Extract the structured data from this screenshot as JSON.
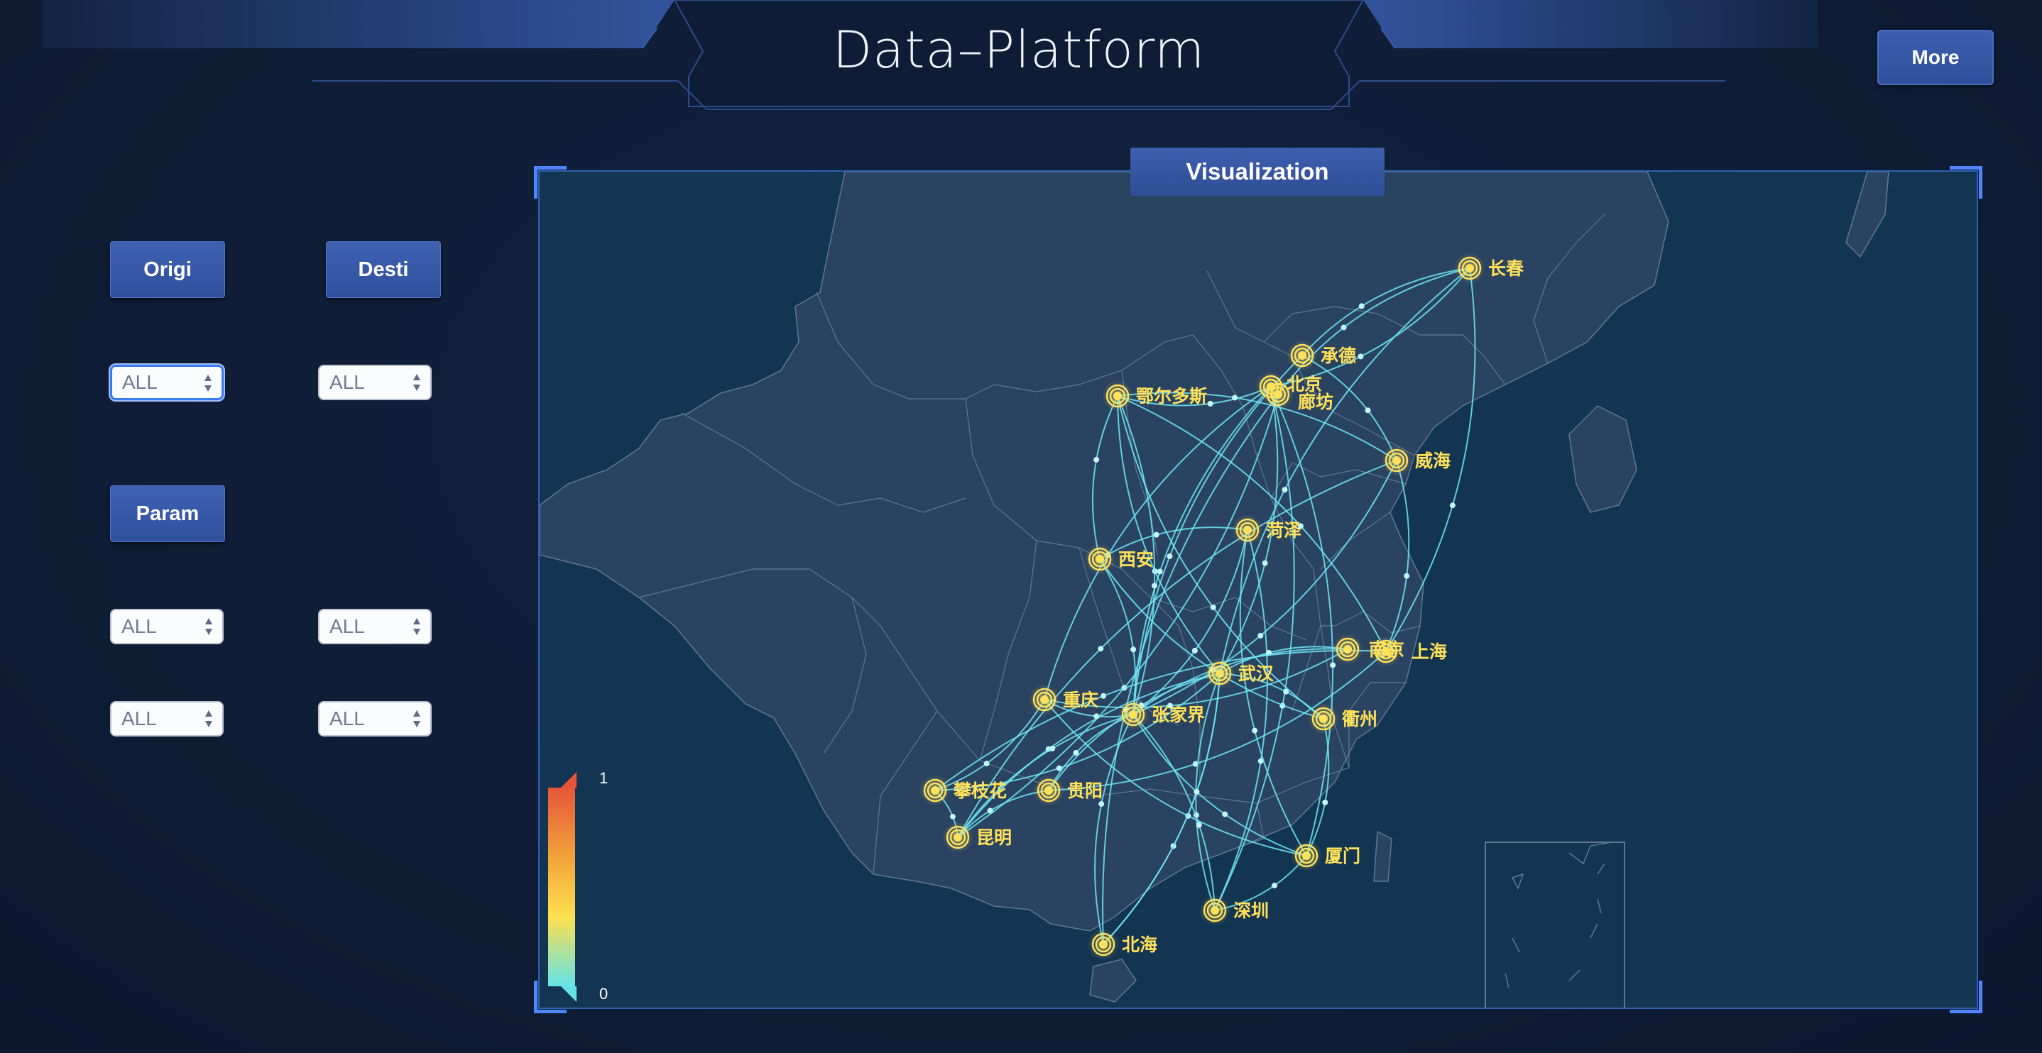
{
  "header": {
    "title": "Data–Platform",
    "more_label": "More"
  },
  "filters": {
    "origin_label": "Origi",
    "destination_label": "Desti",
    "param_label": "Param",
    "origin_value": "ALL",
    "destination_value": "ALL",
    "param_values": [
      "ALL",
      "ALL",
      "ALL",
      "ALL"
    ]
  },
  "visualization": {
    "tab_label": "Visualization",
    "legend": {
      "max_label": "1",
      "min_label": "0"
    },
    "colors": {
      "line": "#6fe6f5",
      "city": "#ffe15a",
      "panel": "#133551",
      "accent": "#3f61b1"
    },
    "cities": [
      "长春",
      "承德",
      "北京",
      "廊坊",
      "鄂尔多斯",
      "威海",
      "菏泽",
      "西安",
      "南京",
      "上海",
      "武汉",
      "重庆",
      "张家界",
      "衢州",
      "攀枝花",
      "贵阳",
      "昆明",
      "厦门",
      "深圳",
      "北海"
    ],
    "flows": [
      [
        "长春",
        "承德"
      ],
      [
        "长春",
        "北京"
      ],
      [
        "长春",
        "廊坊"
      ],
      [
        "长春",
        "上海"
      ],
      [
        "长春",
        "武汉"
      ],
      [
        "北京",
        "武汉"
      ],
      [
        "北京",
        "张家界"
      ],
      [
        "北京",
        "深圳"
      ],
      [
        "北京",
        "重庆"
      ],
      [
        "北京",
        "厦门"
      ],
      [
        "廊坊",
        "北海"
      ],
      [
        "廊坊",
        "昆明"
      ],
      [
        "承德",
        "张家界"
      ],
      [
        "承德",
        "威海"
      ],
      [
        "鄂尔多斯",
        "武汉"
      ],
      [
        "鄂尔多斯",
        "张家界"
      ],
      [
        "鄂尔多斯",
        "北京"
      ],
      [
        "鄂尔多斯",
        "上海"
      ],
      [
        "鄂尔多斯",
        "衢州"
      ],
      [
        "威海",
        "张家界"
      ],
      [
        "威海",
        "鄂尔多斯"
      ],
      [
        "威海",
        "上海"
      ],
      [
        "威海",
        "昆明"
      ],
      [
        "菏泽",
        "张家界"
      ],
      [
        "菏泽",
        "西安"
      ],
      [
        "菏泽",
        "深圳"
      ],
      [
        "菏泽",
        "厦门"
      ],
      [
        "西安",
        "鄂尔多斯"
      ],
      [
        "西安",
        "衢州"
      ],
      [
        "西安",
        "张家界"
      ],
      [
        "南京",
        "张家界"
      ],
      [
        "南京",
        "重庆"
      ],
      [
        "南京",
        "武汉"
      ],
      [
        "上海",
        "贵阳"
      ],
      [
        "上海",
        "攀枝花"
      ],
      [
        "武汉",
        "攀枝花"
      ],
      [
        "武汉",
        "深圳"
      ],
      [
        "武汉",
        "北海"
      ],
      [
        "武汉",
        "昆明"
      ],
      [
        "武汉",
        "衢州"
      ],
      [
        "重庆",
        "厦门"
      ],
      [
        "重庆",
        "攀枝花"
      ],
      [
        "张家界",
        "贵阳"
      ],
      [
        "张家界",
        "深圳"
      ],
      [
        "张家界",
        "厦门"
      ],
      [
        "衢州",
        "厦门"
      ],
      [
        "贵阳",
        "昆明"
      ],
      [
        "攀枝花",
        "昆明"
      ],
      [
        "深圳",
        "厦门"
      ],
      [
        "北海",
        "张家界"
      ],
      [
        "北海",
        "武汉"
      ],
      [
        "昆明",
        "张家界"
      ],
      [
        "重庆",
        "张家界"
      ],
      [
        "贵阳",
        "武汉"
      ]
    ]
  }
}
